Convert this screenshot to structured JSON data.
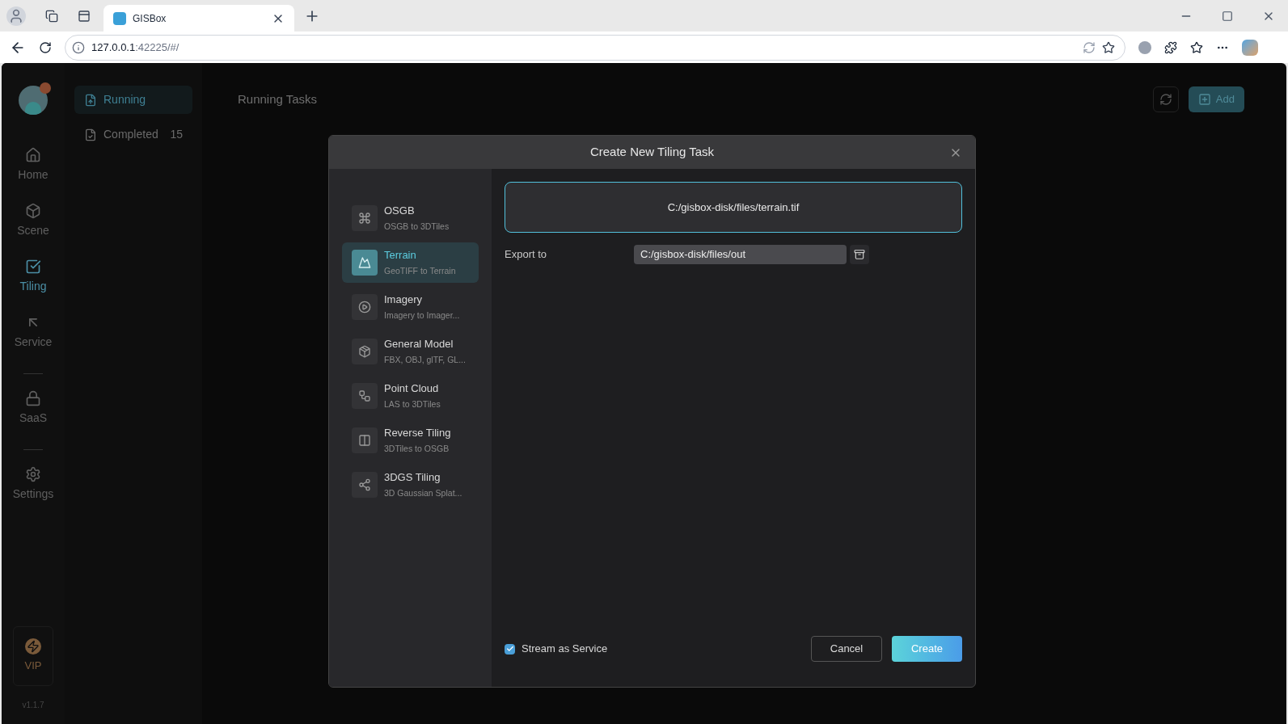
{
  "browser": {
    "tab_title": "GISBox",
    "url_host": "127.0.0.1",
    "url_rest": ":42225/#/"
  },
  "rail": {
    "groups": [
      [
        {
          "label": "Home",
          "selected": false
        },
        {
          "label": "Scene",
          "selected": false
        },
        {
          "label": "Tiling",
          "selected": true
        },
        {
          "label": "Service",
          "selected": false
        }
      ],
      [
        {
          "label": "SaaS",
          "selected": false
        }
      ],
      [
        {
          "label": "Settings",
          "selected": false
        }
      ]
    ],
    "vip": "VIP",
    "version": "v1.1.7"
  },
  "sub_nav": {
    "items": [
      {
        "label": "Running",
        "selected": true
      },
      {
        "label": "Completed",
        "count": "15",
        "selected": false
      }
    ]
  },
  "page": {
    "title": "Running Tasks",
    "add_button": "Add"
  },
  "dialog": {
    "title": "Create New Tiling Task",
    "task_types": [
      {
        "name": "OSGB",
        "description": "OSGB to 3DTiles",
        "selected": false
      },
      {
        "name": "Terrain",
        "description": "GeoTIFF to Terrain",
        "selected": true
      },
      {
        "name": "Imagery",
        "description": "Imagery to Imager...",
        "selected": false
      },
      {
        "name": "General Model",
        "description": "FBX, OBJ, glTF, GL...",
        "selected": false
      },
      {
        "name": "Point Cloud",
        "description": "LAS to 3DTiles",
        "selected": false
      },
      {
        "name": "Reverse Tiling",
        "description": "3DTiles to OSGB",
        "selected": false
      },
      {
        "name": "3DGS Tiling",
        "description": "3D Gaussian Splat...",
        "selected": false
      }
    ],
    "input_file": "C:/gisbox-disk/files/terrain.tif",
    "export_label": "Export to",
    "export_path": "C:/gisbox-disk/files/out",
    "stream": {
      "label": "Stream as Service",
      "checked": true
    },
    "cancel": "Cancel",
    "create": "Create"
  }
}
